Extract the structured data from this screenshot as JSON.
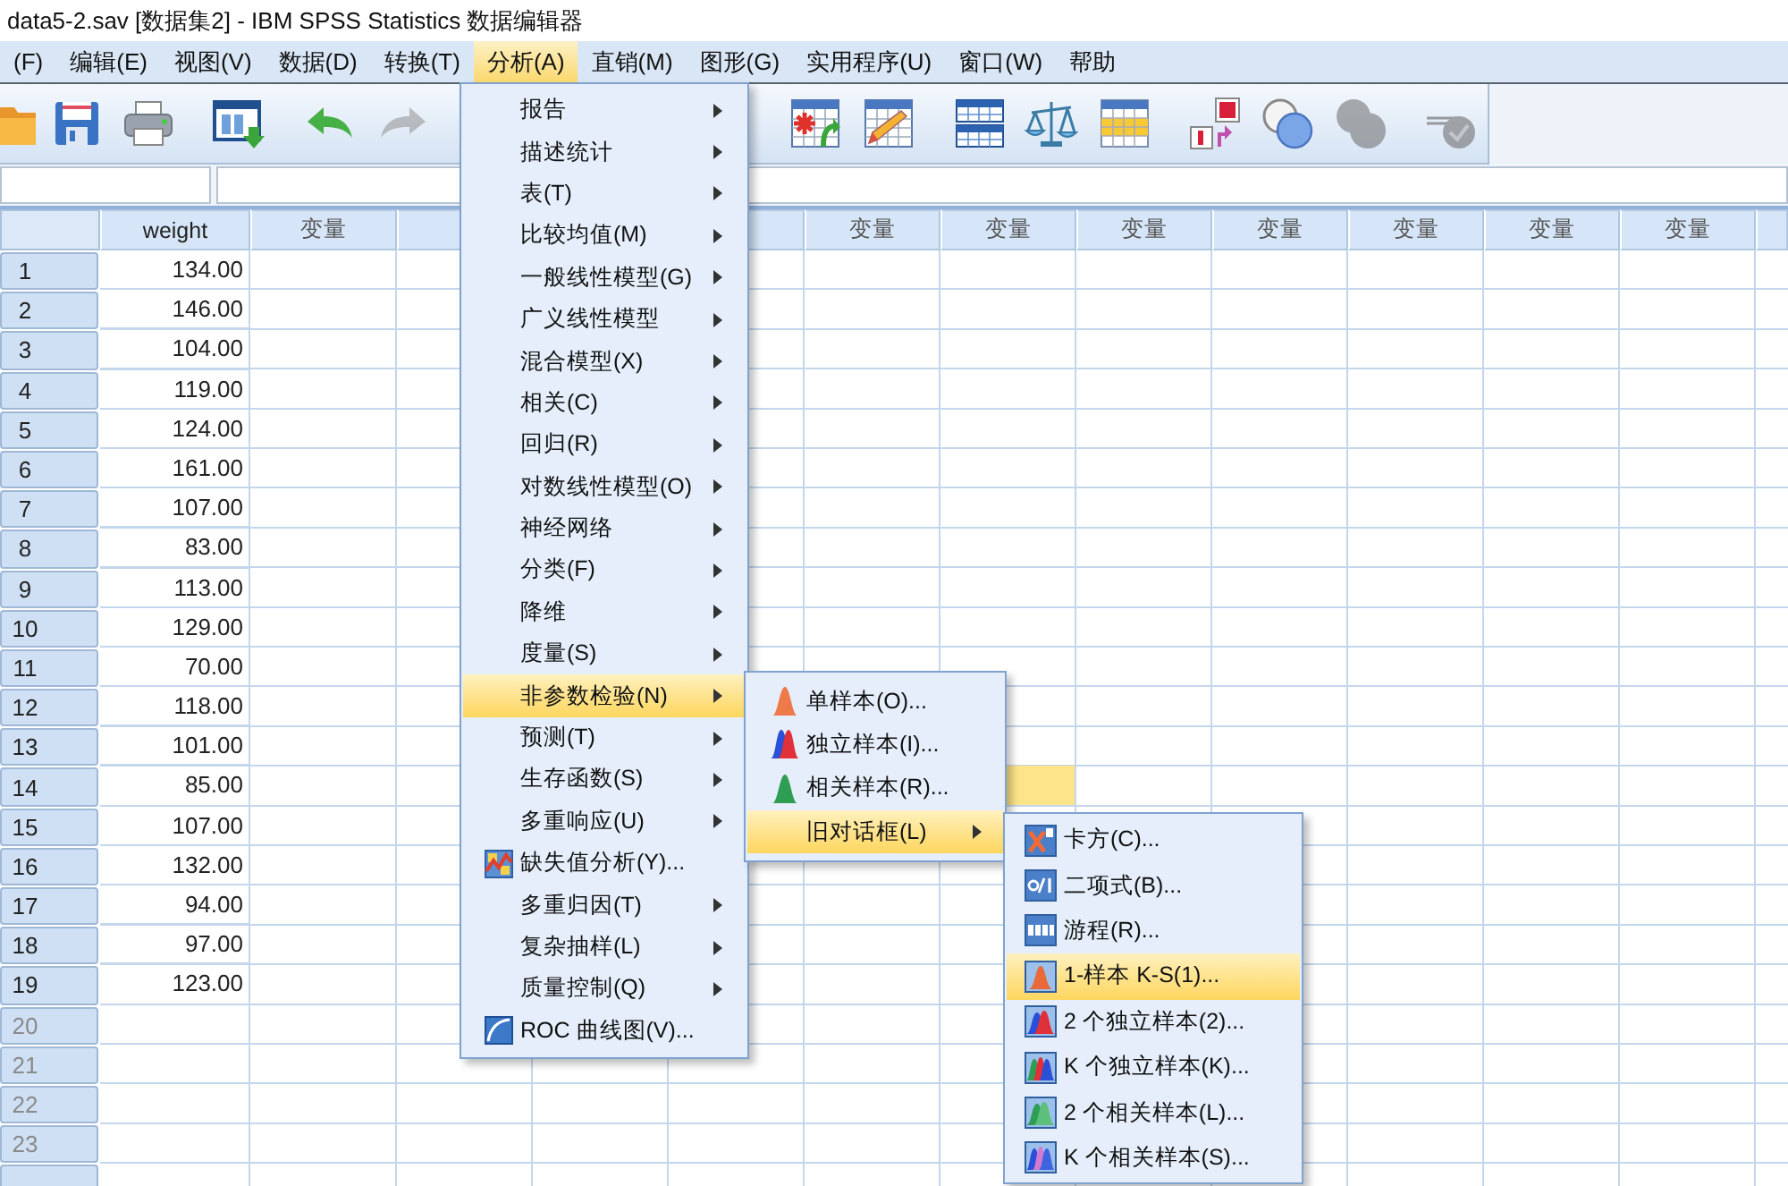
{
  "window": {
    "title": "data5-2.sav [数据集2] - IBM SPSS Statistics 数据编辑器"
  },
  "menu_bar": [
    {
      "label": "(F)",
      "selected": false
    },
    {
      "label": "编辑(E)",
      "selected": false
    },
    {
      "label": "视图(V)",
      "selected": false
    },
    {
      "label": "数据(D)",
      "selected": false
    },
    {
      "label": "转换(T)",
      "selected": false
    },
    {
      "label": "分析(A)",
      "selected": true
    },
    {
      "label": "直销(M)",
      "selected": false
    },
    {
      "label": "图形(G)",
      "selected": false
    },
    {
      "label": "实用程序(U)",
      "selected": false
    },
    {
      "label": "窗口(W)",
      "selected": false
    },
    {
      "label": "帮助",
      "selected": false
    }
  ],
  "toolbar": [
    {
      "disabled": false
    },
    {
      "disabled": false
    },
    {
      "disabled": false
    },
    {
      "disabled": false
    },
    {
      "disabled": false
    },
    {
      "disabled": true
    },
    {
      "disabled": false
    },
    {
      "disabled": false
    },
    {
      "disabled": false
    },
    {
      "disabled": false
    },
    {
      "disabled": false
    },
    {
      "disabled": false
    },
    {
      "disabled": false
    },
    {
      "disabled": true
    },
    {
      "disabled": true
    }
  ],
  "grid": {
    "columns": [
      "weight",
      "变量",
      null,
      null,
      null,
      "变量",
      "变量",
      "变量",
      "变量",
      "变量",
      "变量",
      "变量",
      null
    ],
    "rows": [
      {
        "number": "1",
        "has_data": true,
        "cells": [
          {
            "value": "134.00",
            "selected": false
          }
        ]
      },
      {
        "number": "2",
        "has_data": true,
        "cells": [
          {
            "value": "146.00",
            "selected": false
          }
        ]
      },
      {
        "number": "3",
        "has_data": true,
        "cells": [
          {
            "value": "104.00",
            "selected": false
          }
        ]
      },
      {
        "number": "4",
        "has_data": true,
        "cells": [
          {
            "value": "119.00",
            "selected": false
          }
        ]
      },
      {
        "number": "5",
        "has_data": true,
        "cells": [
          {
            "value": "124.00",
            "selected": false
          }
        ]
      },
      {
        "number": "6",
        "has_data": true,
        "cells": [
          {
            "value": "161.00",
            "selected": false
          }
        ]
      },
      {
        "number": "7",
        "has_data": true,
        "cells": [
          {
            "value": "107.00",
            "selected": false
          }
        ]
      },
      {
        "number": "8",
        "has_data": true,
        "cells": [
          {
            "value": "83.00",
            "selected": false
          }
        ]
      },
      {
        "number": "9",
        "has_data": true,
        "cells": [
          {
            "value": "113.00",
            "selected": false
          }
        ]
      },
      {
        "number": "10",
        "has_data": true,
        "cells": [
          {
            "value": "129.00",
            "selected": false
          }
        ]
      },
      {
        "number": "11",
        "has_data": true,
        "cells": [
          {
            "value": "70.00",
            "selected": false
          }
        ]
      },
      {
        "number": "12",
        "has_data": true,
        "cells": [
          {
            "value": "118.00",
            "selected": false
          }
        ]
      },
      {
        "number": "13",
        "has_data": true,
        "cells": [
          {
            "value": "101.00",
            "selected": false
          }
        ]
      },
      {
        "number": "14",
        "has_data": true,
        "cells": [
          {
            "value": "85.00",
            "selected": false
          },
          null,
          null,
          null,
          null,
          null,
          {
            "selected": true
          }
        ]
      },
      {
        "number": "15",
        "has_data": true,
        "cells": [
          {
            "value": "107.00",
            "selected": false
          }
        ]
      },
      {
        "number": "16",
        "has_data": true,
        "cells": [
          {
            "value": "132.00",
            "selected": false
          }
        ]
      },
      {
        "number": "17",
        "has_data": true,
        "cells": [
          {
            "value": "94.00",
            "selected": false
          }
        ]
      },
      {
        "number": "18",
        "has_data": true,
        "cells": [
          {
            "value": "97.00",
            "selected": false
          }
        ]
      },
      {
        "number": "19",
        "has_data": true,
        "cells": [
          {
            "value": "123.00",
            "selected": false
          }
        ]
      },
      {
        "number": "20",
        "has_data": false
      },
      {
        "number": "21",
        "has_data": false
      },
      {
        "number": "22",
        "has_data": false
      },
      {
        "number": "23",
        "has_data": false
      }
    ]
  },
  "analyze_menu": {
    "items": [
      {
        "label": "报告",
        "kind": "submenu",
        "selected": false
      },
      {
        "label": "描述统计",
        "kind": "submenu",
        "selected": false
      },
      {
        "label": "表(T)",
        "kind": "submenu",
        "selected": false
      },
      {
        "label": "比较均值(M)",
        "kind": "submenu",
        "selected": false
      },
      {
        "label": "一般线性模型(G)",
        "kind": "submenu",
        "selected": false
      },
      {
        "label": "广义线性模型",
        "kind": "submenu",
        "selected": false
      },
      {
        "label": "混合模型(X)",
        "kind": "submenu",
        "selected": false
      },
      {
        "label": "相关(C)",
        "kind": "submenu",
        "selected": false
      },
      {
        "label": "回归(R)",
        "kind": "submenu",
        "selected": false
      },
      {
        "label": "对数线性模型(O)",
        "kind": "submenu",
        "selected": false
      },
      {
        "label": "神经网络",
        "kind": "submenu",
        "selected": false
      },
      {
        "label": "分类(F)",
        "kind": "submenu",
        "selected": false
      },
      {
        "label": "降维",
        "kind": "submenu",
        "selected": false
      },
      {
        "label": "度量(S)",
        "kind": "submenu",
        "selected": false
      },
      {
        "label": "非参数检验(N)",
        "kind": "submenu",
        "selected": true
      },
      {
        "label": "预测(T)",
        "kind": "submenu",
        "selected": false
      },
      {
        "label": "生存函数(S)",
        "kind": "submenu",
        "selected": false
      },
      {
        "label": "多重响应(U)",
        "kind": "submenu",
        "selected": false
      },
      {
        "label": "缺失值分析(Y)...",
        "kind": "dialog",
        "selected": false
      },
      {
        "label": "多重归因(T)",
        "kind": "submenu",
        "selected": false
      },
      {
        "label": "复杂抽样(L)",
        "kind": "submenu",
        "selected": false
      },
      {
        "label": "质量控制(Q)",
        "kind": "submenu",
        "selected": false
      },
      {
        "label": "ROC 曲线图(V)...",
        "kind": "dialog",
        "selected": false
      }
    ]
  },
  "nonparametric_menu": {
    "items": [
      {
        "label": "单样本(O)...",
        "kind": "dialog",
        "selected": false
      },
      {
        "label": "独立样本(I)...",
        "kind": "dialog",
        "selected": false
      },
      {
        "label": "相关样本(R)...",
        "kind": "dialog",
        "selected": false
      },
      {
        "label": "旧对话框(L)",
        "kind": "submenu",
        "selected": true
      }
    ]
  },
  "legacy_dialogs_menu": {
    "items": [
      {
        "label": "卡方(C)...",
        "kind": "dialog",
        "selected": false
      },
      {
        "label": "二项式(B)...",
        "kind": "dialog",
        "selected": false
      },
      {
        "label": "游程(R)...",
        "kind": "dialog",
        "selected": false
      },
      {
        "label": "1-样本 K-S(1)...",
        "kind": "dialog",
        "selected": true
      },
      {
        "label": "2 个独立样本(2)...",
        "kind": "dialog",
        "selected": false
      },
      {
        "label": "K 个独立样本(K)...",
        "kind": "dialog",
        "selected": false
      },
      {
        "label": "2 个相关样本(L)...",
        "kind": "dialog",
        "selected": false
      },
      {
        "label": "K 个相关样本(S)...",
        "kind": "dialog",
        "selected": false
      }
    ]
  }
}
